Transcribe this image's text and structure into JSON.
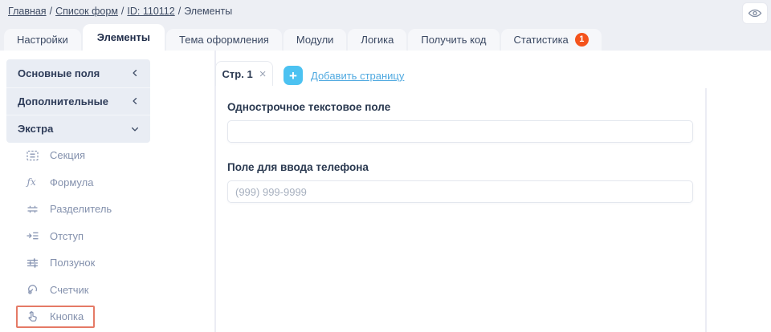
{
  "breadcrumb": {
    "separator": "/",
    "items": [
      {
        "label": "Главная",
        "link": true
      },
      {
        "label": "Список форм",
        "link": true
      },
      {
        "label": "ID: 110112",
        "link": true
      },
      {
        "label": "Элементы",
        "link": false
      }
    ]
  },
  "topbar": {
    "preview_icon": "eye-icon"
  },
  "tabs": [
    {
      "label": "Настройки",
      "active": false
    },
    {
      "label": "Элементы",
      "active": true
    },
    {
      "label": "Тема оформления",
      "active": false
    },
    {
      "label": "Модули",
      "active": false
    },
    {
      "label": "Логика",
      "active": false
    },
    {
      "label": "Получить код",
      "active": false
    },
    {
      "label": "Статистика",
      "active": false,
      "badge": "1"
    }
  ],
  "sidebar": {
    "groups": [
      {
        "label": "Основные поля",
        "state": "collapsed"
      },
      {
        "label": "Дополнительные",
        "state": "collapsed"
      },
      {
        "label": "Экстра",
        "state": "expanded"
      }
    ],
    "items": [
      {
        "label": "Секция",
        "icon": "section-icon"
      },
      {
        "label": "Формула",
        "icon": "formula-icon"
      },
      {
        "label": "Разделитель",
        "icon": "divider-icon"
      },
      {
        "label": "Отступ",
        "icon": "indent-icon"
      },
      {
        "label": "Ползунок",
        "icon": "slider-icon"
      },
      {
        "label": "Счетчик",
        "icon": "counter-icon"
      },
      {
        "label": "Кнопка",
        "icon": "button-icon",
        "highlighted": true
      }
    ]
  },
  "pages": {
    "tab_label": "Стр. 1",
    "close_label": "×",
    "add_button": "+",
    "add_label": "Добавить страницу"
  },
  "form": {
    "fields": [
      {
        "label": "Однострочное текстовое поле",
        "value": "",
        "placeholder": ""
      },
      {
        "label": "Поле для ввода телефона",
        "value": "",
        "placeholder": "(999) 999-9999"
      }
    ]
  },
  "colors": {
    "accent_blue": "#4cc2f1",
    "link_blue": "#4fa9e0",
    "badge_orange": "#f4531c",
    "highlight_red": "#e57a66",
    "sidebar_bg": "#e9edf4",
    "page_bg": "#edeff4"
  }
}
